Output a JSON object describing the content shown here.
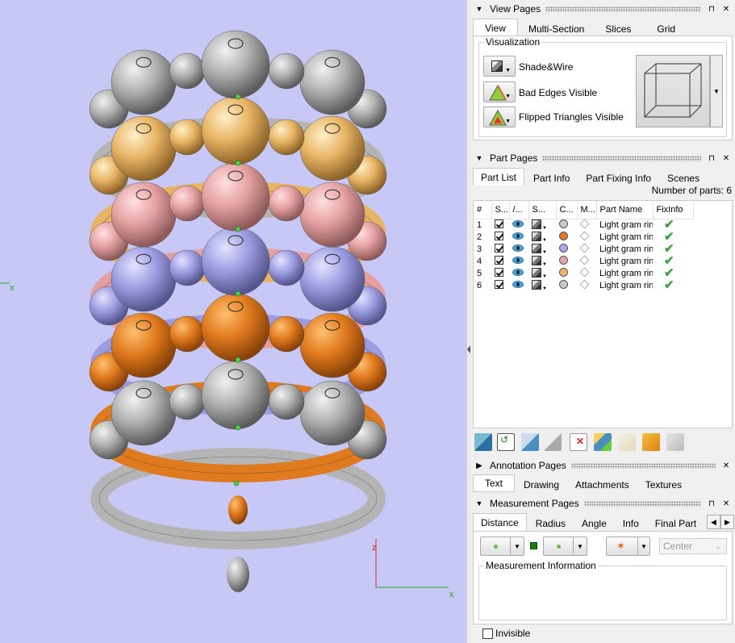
{
  "axes": {
    "x1": "x",
    "z": "z",
    "x2": "x"
  },
  "view_pages": {
    "title": "View Pages",
    "tabs": [
      "View",
      "Multi-Section",
      "Slices",
      "Grid"
    ],
    "group_label": "Visualization",
    "buttons": [
      {
        "label": "Shade&Wire",
        "icon": "shade-wire-icon"
      },
      {
        "label": "Bad Edges Visible",
        "icon": "bad-edges-icon"
      },
      {
        "label": "Flipped Triangles Visible",
        "icon": "flipped-triangles-icon"
      }
    ]
  },
  "part_pages": {
    "title": "Part Pages",
    "tabs": [
      "Part List",
      "Part Info",
      "Part Fixing Info",
      "Scenes"
    ],
    "count_text": "Number of parts: 6",
    "columns": [
      "#",
      "S...",
      "/...",
      "S...",
      "C...",
      "M...",
      "Part Name",
      "FixInfo"
    ],
    "rows": [
      {
        "num": "1",
        "name": "Light gram ring",
        "color": "#c8c8c8"
      },
      {
        "num": "2",
        "name": "Light gram ring",
        "color": "#e07a26"
      },
      {
        "num": "3",
        "name": "Light gram ring",
        "color": "#a9a9e8"
      },
      {
        "num": "4",
        "name": "Light gram ring",
        "color": "#e8a6a6"
      },
      {
        "num": "5",
        "name": "Light gram ring",
        "color": "#f0b46a"
      },
      {
        "num": "6",
        "name": "Light gram ring",
        "color": "#c8c8c8"
      }
    ]
  },
  "annotation_pages": {
    "title": "Annotation Pages",
    "tabs": [
      "Text",
      "Drawing",
      "Attachments",
      "Textures"
    ]
  },
  "measurement_pages": {
    "title": "Measurement Pages",
    "tabs": [
      "Distance",
      "Radius",
      "Angle",
      "Info",
      "Final Part"
    ],
    "mode_value": "Center",
    "group_label": "Measurement Information",
    "checkbox_label": "Invisible"
  },
  "colors": {
    "viewport_bg": "#c8c8f6",
    "gray": "#b4b4b4",
    "orange": "#e07a1e",
    "purple": "#9c9ce2",
    "pink": "#e4a0a0",
    "gold": "#e8b464"
  }
}
